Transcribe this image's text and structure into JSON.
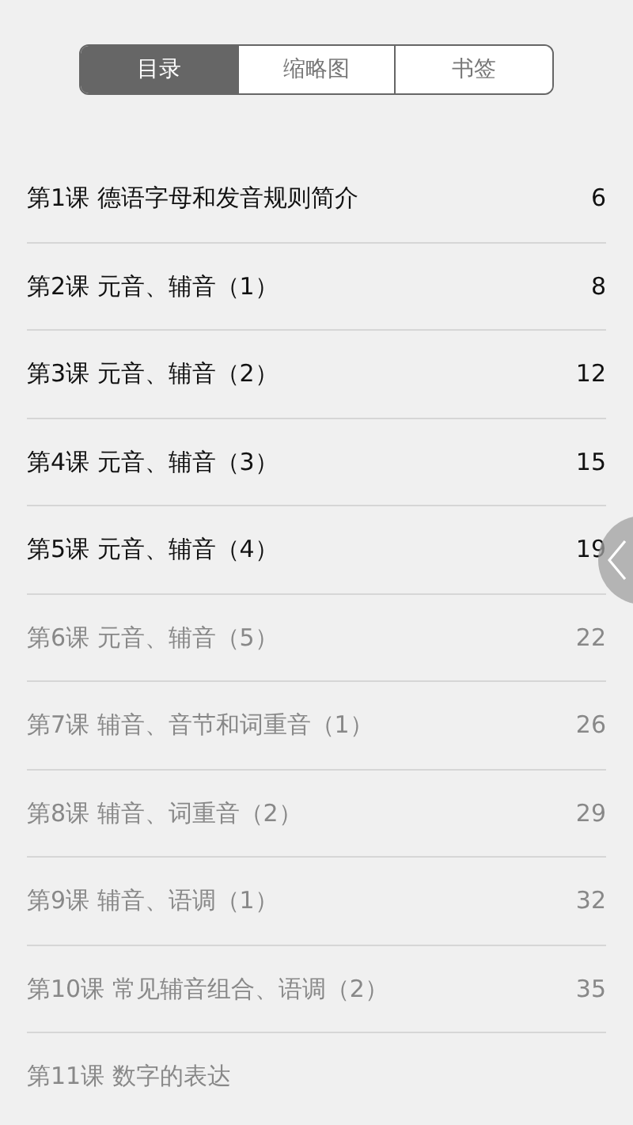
{
  "tabs": [
    {
      "label": "目录",
      "selected": true
    },
    {
      "label": "缩略图",
      "selected": false
    },
    {
      "label": "书签",
      "selected": false
    }
  ],
  "chapters": [
    {
      "title": "第1课 德语字母和发音规则简介",
      "page": "6",
      "greyed": false
    },
    {
      "title": "第2课 元音、辅音（1）",
      "page": "8",
      "greyed": false
    },
    {
      "title": "第3课 元音、辅音（2）",
      "page": "12",
      "greyed": false
    },
    {
      "title": "第4课 元音、辅音（3）",
      "page": "15",
      "greyed": false
    },
    {
      "title": "第5课 元音、辅音（4）",
      "page": "19",
      "greyed": false
    },
    {
      "title": "第6课 元音、辅音（5）",
      "page": "22",
      "greyed": true
    },
    {
      "title": "第7课 辅音、音节和词重音（1）",
      "page": "26",
      "greyed": true
    },
    {
      "title": "第8课 辅音、词重音（2）",
      "page": "29",
      "greyed": true
    },
    {
      "title": "第9课 辅音、语调（1）",
      "page": "32",
      "greyed": true
    },
    {
      "title": "第10课 常见辅音组合、语调（2）",
      "page": "35",
      "greyed": true
    },
    {
      "title": "第11课 数字的表达",
      "greyed": true
    }
  ]
}
